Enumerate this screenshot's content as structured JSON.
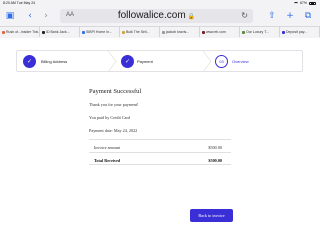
{
  "status_bar": {
    "time": "8:20 AM",
    "date": "Tue May 24",
    "battery": "67%"
  },
  "browser": {
    "text_size_label": "AA",
    "url": "followalice.com",
    "tabs": [
      {
        "label": "Rush of...insider Trai...",
        "color": "#e0663a"
      },
      {
        "label": "ID Bank Jack...",
        "color": "#222222"
      },
      {
        "label": "SIBPI Home In...",
        "color": "#2f6fea"
      },
      {
        "label": "Bulk The Sell...",
        "color": "#d0a43a"
      },
      {
        "label": "jackob kravis...",
        "color": "#999999"
      },
      {
        "label": "www.eb.com",
        "color": "#7a1d2a"
      },
      {
        "label": "Our Luxury T...",
        "color": "#5a8a3a"
      },
      {
        "label": "Deposit pay...",
        "color": "#3a2fd6"
      }
    ]
  },
  "stepper": {
    "steps": [
      {
        "label": "Billing Address",
        "state": "done"
      },
      {
        "label": "Payment",
        "state": "done"
      },
      {
        "label": "Overview",
        "state": "current",
        "number": "03"
      }
    ]
  },
  "confirmation": {
    "title": "Payment Successful",
    "thank_you": "Thank you for your payment!",
    "paid_by": "You paid by Credit Card",
    "payment_date": "Payment date: May 24, 2022"
  },
  "summary": {
    "rows": [
      {
        "label": "Invoice amount",
        "amount": "$500.00"
      },
      {
        "label": "Total Received",
        "amount": "$500.00"
      }
    ]
  },
  "actions": {
    "back_label": "Back to invoice"
  },
  "colors": {
    "accent": "#3a2fd6"
  }
}
